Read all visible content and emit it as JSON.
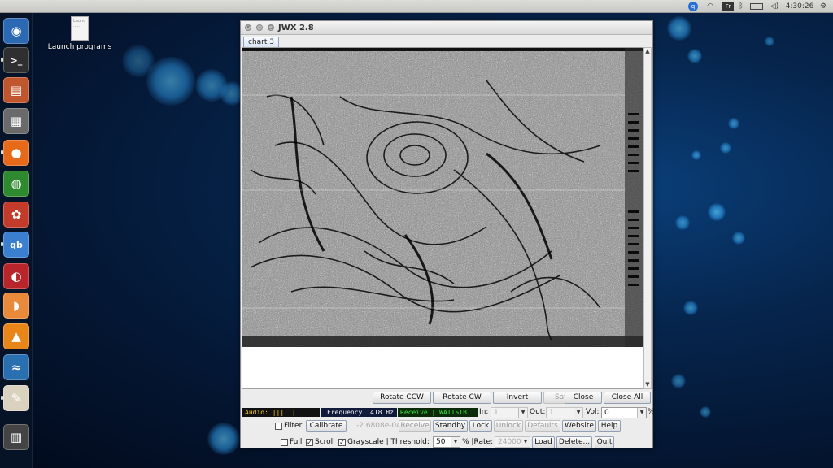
{
  "top_panel": {
    "clock": "4:30:26",
    "keyboard_indicator": "Fr"
  },
  "desktop_icon": {
    "label": "Launch programs",
    "doc_text": "Launc\n....."
  },
  "launcher": {
    "items": [
      {
        "name": "ubuntu-logo-icon",
        "glyph": "◉",
        "color": "#2b6ab3"
      },
      {
        "name": "terminal-icon",
        "glyph": ">_",
        "color": "#2f2f2f"
      },
      {
        "name": "file-manager-icon",
        "glyph": "▤",
        "color": "#c0562d"
      },
      {
        "name": "calculator-icon",
        "glyph": "▦",
        "color": "#6a6a6a"
      },
      {
        "name": "firefox-icon",
        "glyph": "●",
        "color": "#e66a1a"
      },
      {
        "name": "globe-network-icon",
        "glyph": "◍",
        "color": "#2f8a2f"
      },
      {
        "name": "system-settings-icon",
        "glyph": "✿",
        "color": "#c23b2b"
      },
      {
        "name": "qbittorrent-icon",
        "glyph": "qb",
        "color": "#3a7fd0"
      },
      {
        "name": "media-player-icon",
        "glyph": "◐",
        "color": "#b8252a"
      },
      {
        "name": "orange-app-icon",
        "glyph": "◗",
        "color": "#e88a3a"
      },
      {
        "name": "vlc-icon",
        "glyph": "▲",
        "color": "#e8861a"
      },
      {
        "name": "dolphin-app-icon",
        "glyph": "≈",
        "color": "#2a6fb0"
      },
      {
        "name": "text-editor-icon",
        "glyph": "✎",
        "color": "#d8d2bf"
      },
      {
        "name": "trash-icon",
        "glyph": "▥",
        "color": "#444"
      }
    ]
  },
  "window": {
    "title": "JWX 2.8",
    "tab_label": "chart 3",
    "buttons_row1": {
      "rotate_ccw": "Rotate CCW",
      "rotate_cw": "Rotate CW",
      "invert": "Invert",
      "save": "Save",
      "close": "Close",
      "close_all": "Close All"
    },
    "status": {
      "audio": "Audio: ||||||",
      "frequency_label": "Frequency",
      "frequency_value": "418 Hz",
      "receive_state": "Receive | WAITSTB"
    },
    "in_label": "In:",
    "in_value": "1",
    "out_label": "Out:",
    "out_value": "1",
    "vol_label": "Vol:",
    "vol_value": "0",
    "percent_sign": "%",
    "row3": {
      "filter": "Filter",
      "calibrate": "Calibrate",
      "calibration_value": "-2.6808e-04",
      "receive": "Receive",
      "standby": "Standby",
      "lock": "Lock",
      "unlock": "Unlock",
      "defaults": "Defaults",
      "website": "Website",
      "help": "Help"
    },
    "row4": {
      "full": "Full",
      "scroll": "Scroll",
      "grayscale": "Grayscale | Threshold:",
      "threshold_value": "50",
      "threshold_suffix": "% |Rate:",
      "rate_value": "24000",
      "load": "Load",
      "delete": "Delete...",
      "quit": "Quit"
    },
    "checkboxes": {
      "filter_checked": false,
      "full_checked": false,
      "scroll_checked": true,
      "grayscale_checked": true
    }
  },
  "colors": {
    "audio_bg": "#111111",
    "audio_fg": "#ffd400",
    "freq_bg": "#101a3a",
    "receive_bg": "#0a2a0a",
    "receive_fg": "#3ce43c"
  }
}
